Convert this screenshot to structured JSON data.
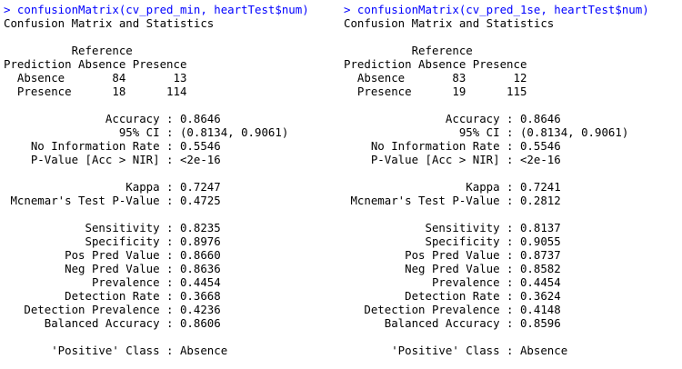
{
  "colors": {
    "background": "#ffffff",
    "command_text": "#0000ff",
    "output_text": "#000000"
  },
  "left": {
    "command": "> confusionMatrix(cv_pred_min, heartTest$num)",
    "lines": [
      "Confusion Matrix and Statistics",
      "",
      "          Reference",
      "Prediction Absence Presence",
      "  Absence       84       13",
      "  Presence      18      114",
      "",
      "               Accuracy : 0.8646",
      "                 95% CI : (0.8134, 0.9061)",
      "    No Information Rate : 0.5546",
      "    P-Value [Acc > NIR] : <2e-16",
      "",
      "                  Kappa : 0.7247",
      " Mcnemar's Test P-Value : 0.4725",
      "",
      "            Sensitivity : 0.8235",
      "            Specificity : 0.8976",
      "         Pos Pred Value : 0.8660",
      "         Neg Pred Value : 0.8636",
      "             Prevalence : 0.4454",
      "         Detection Rate : 0.3668",
      "   Detection Prevalence : 0.4236",
      "      Balanced Accuracy : 0.8606",
      "",
      "       'Positive' Class : Absence"
    ]
  },
  "right": {
    "command": "> confusionMatrix(cv_pred_1se, heartTest$num)",
    "lines": [
      "Confusion Matrix and Statistics",
      "",
      "          Reference",
      "Prediction Absence Presence",
      "  Absence       83       12",
      "  Presence      19      115",
      "",
      "               Accuracy : 0.8646",
      "                 95% CI : (0.8134, 0.9061)",
      "    No Information Rate : 0.5546",
      "    P-Value [Acc > NIR] : <2e-16",
      "",
      "                  Kappa : 0.7241",
      " Mcnemar's Test P-Value : 0.2812",
      "",
      "            Sensitivity : 0.8137",
      "            Specificity : 0.9055",
      "         Pos Pred Value : 0.8737",
      "         Neg Pred Value : 0.8582",
      "             Prevalence : 0.4454",
      "         Detection Rate : 0.3624",
      "   Detection Prevalence : 0.4148",
      "      Balanced Accuracy : 0.8596",
      "",
      "       'Positive' Class : Absence"
    ]
  }
}
